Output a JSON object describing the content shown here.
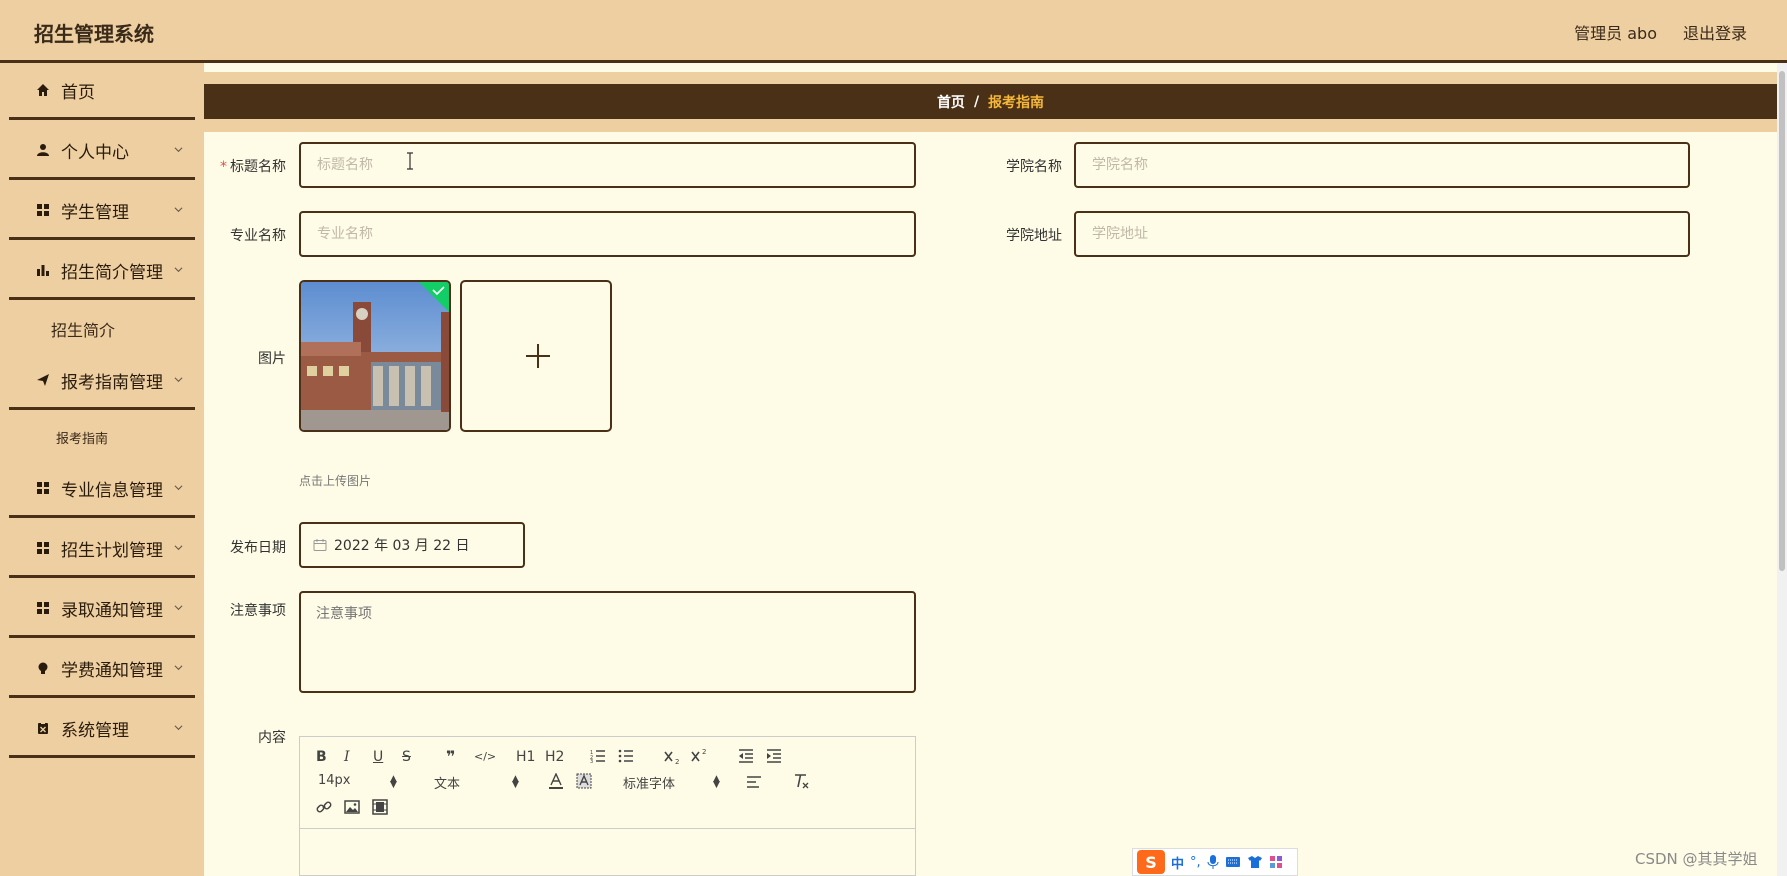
{
  "header": {
    "title": "招生管理系统",
    "user": "管理员 abo",
    "logout": "退出登录"
  },
  "sidebar": {
    "items": [
      {
        "label": "首页",
        "icon": "home-icon"
      },
      {
        "label": "个人中心",
        "icon": "user-icon"
      },
      {
        "label": "学生管理",
        "icon": "grid-icon"
      },
      {
        "label": "招生简介管理",
        "icon": "bar-chart-icon"
      },
      {
        "label": "报考指南管理",
        "icon": "paper-plane-icon"
      },
      {
        "label": "专业信息管理",
        "icon": "grid-icon"
      },
      {
        "label": "招生计划管理",
        "icon": "grid-icon"
      },
      {
        "label": "录取通知管理",
        "icon": "grid-icon"
      },
      {
        "label": "学费通知管理",
        "icon": "bulb-icon"
      },
      {
        "label": "系统管理",
        "icon": "clipboard-icon"
      }
    ],
    "sub_items": {
      "intro": "招生简介",
      "guide": "报考指南"
    }
  },
  "breadcrumb": {
    "home": "首页",
    "separator": "/",
    "current": "报考指南"
  },
  "form": {
    "title": {
      "label": "标题名称",
      "placeholder": "标题名称",
      "required": "*"
    },
    "college": {
      "label": "学院名称",
      "placeholder": "学院名称"
    },
    "major": {
      "label": "专业名称",
      "placeholder": "专业名称"
    },
    "address": {
      "label": "学院地址",
      "placeholder": "学院地址"
    },
    "image": {
      "label": "图片",
      "tip": "点击上传图片"
    },
    "date": {
      "label": "发布日期",
      "value": "2022 年 03 月 22 日"
    },
    "notes": {
      "label": "注意事项",
      "placeholder": "注意事项"
    },
    "content": {
      "label": "内容"
    }
  },
  "editor": {
    "font_size": "14px",
    "block_format": "文本",
    "font_family": "标准字体",
    "buttons_row1": [
      "B",
      "I",
      "U",
      "S",
      "❞",
      "</>",
      "H1",
      "H2"
    ]
  },
  "ime": {
    "mode": "中"
  },
  "watermark": "CSDN @其其学姐",
  "colors": {
    "header_bg": "#eecfa1",
    "accent_dark": "#4a3016",
    "page_bg": "#fefbe6",
    "breadcrumb_current": "#f5b73a"
  }
}
